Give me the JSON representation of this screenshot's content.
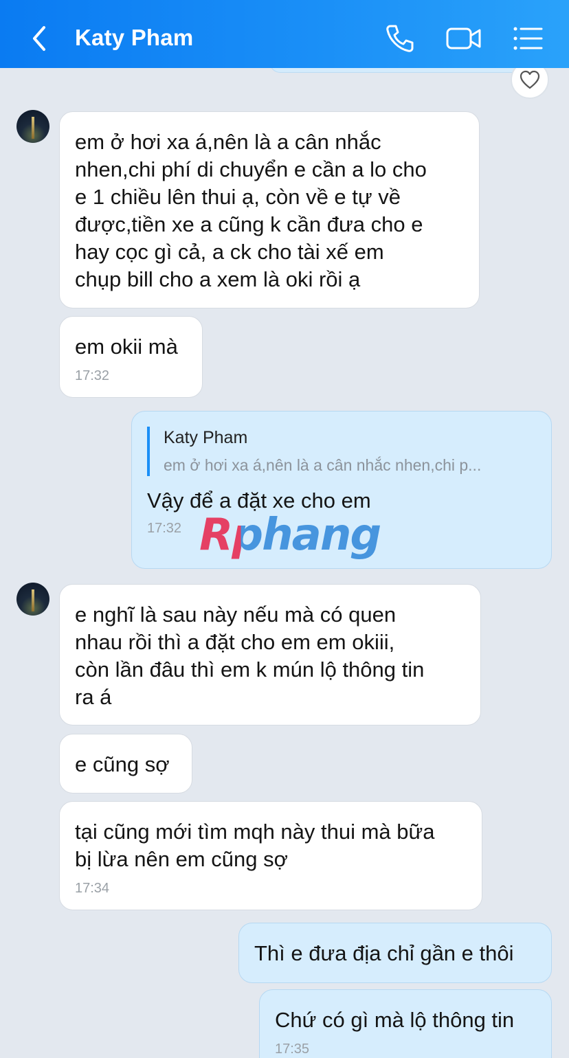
{
  "header": {
    "contact_name": "Katy Pham",
    "icons": [
      "back-icon",
      "phone-icon",
      "video-call-icon",
      "menu-icon"
    ]
  },
  "watermark": "Rphang",
  "colors": {
    "header": "#0a7bf2",
    "incoming": "#ffffff",
    "outgoing": "#d6edfd",
    "quote_bar": "#1a8ff7"
  },
  "messages": [
    {
      "from": "contact",
      "text": "em ở hơi xa á,nên là a cân nhắc\nnhen,chi phí di chuyển e cần a lo cho\ne 1 chiều lên thui ạ, còn về e tự về\nđược,tiền xe a cũng k cần đưa cho e\nhay cọc gì cả, a ck cho tài xế em\nchụp bill cho a xem là oki rồi ạ"
    },
    {
      "from": "contact",
      "text": "em okii mà",
      "time": "17:32"
    },
    {
      "from": "me",
      "quote_name": "Katy Pham",
      "quote_text": "em ở hơi xa á,nên là a cân nhắc nhen,chi p...",
      "text": "Vậy để a đặt xe cho em",
      "time": "17:32"
    },
    {
      "from": "contact",
      "text": "e nghĩ là sau này nếu mà có quen\nnhau rồi thì a đặt cho em em okiii,\ncòn lần đâu thì em k mún lộ thông tin\nra á"
    },
    {
      "from": "contact",
      "text": "e cũng sợ"
    },
    {
      "from": "contact",
      "text": "tại cũng mới tìm mqh này thui mà bữa\nbị lừa nên em cũng sợ",
      "time": "17:34"
    },
    {
      "from": "me",
      "text": "Thì e đưa địa chỉ gần e thôi"
    },
    {
      "from": "me",
      "text": "Chứ có gì mà lộ thông tin",
      "time": "17:35"
    }
  ]
}
